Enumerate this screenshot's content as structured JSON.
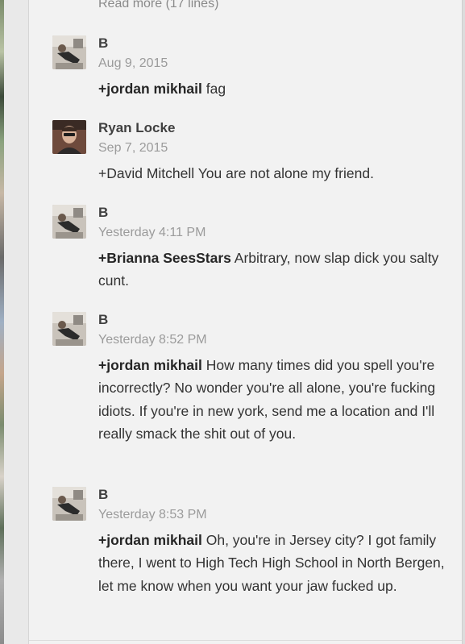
{
  "read_more": "Read more (17 lines)",
  "comments": [
    {
      "author": "B",
      "date": "Aug 9, 2015",
      "mention": "+jordan mikhail",
      "text": " fag"
    },
    {
      "author": "Ryan Locke",
      "date": "Sep 7, 2015",
      "mention": "",
      "text": "+David Mitchell You are not alone my friend."
    },
    {
      "author": "B",
      "date": "Yesterday 4:11 PM",
      "mention": "+Brianna SeesStars",
      "text": " Arbitrary, now slap dick you salty cunt."
    },
    {
      "author": "B",
      "date": "Yesterday 8:52 PM",
      "mention": "+jordan mikhail",
      "text": " How many times did you spell you're incorrectly? No wonder you're all alone, you're fucking idiots. If you're in new york, send me a location and I'll really smack the shit out of you."
    },
    {
      "author": "B",
      "date": "Yesterday 8:53 PM",
      "mention": "+jordan mikhail",
      "text": " Oh, you're in Jersey city? I got family there, I went to High Tech High School in North Bergen, let me know when you want your jaw fucked up."
    }
  ]
}
